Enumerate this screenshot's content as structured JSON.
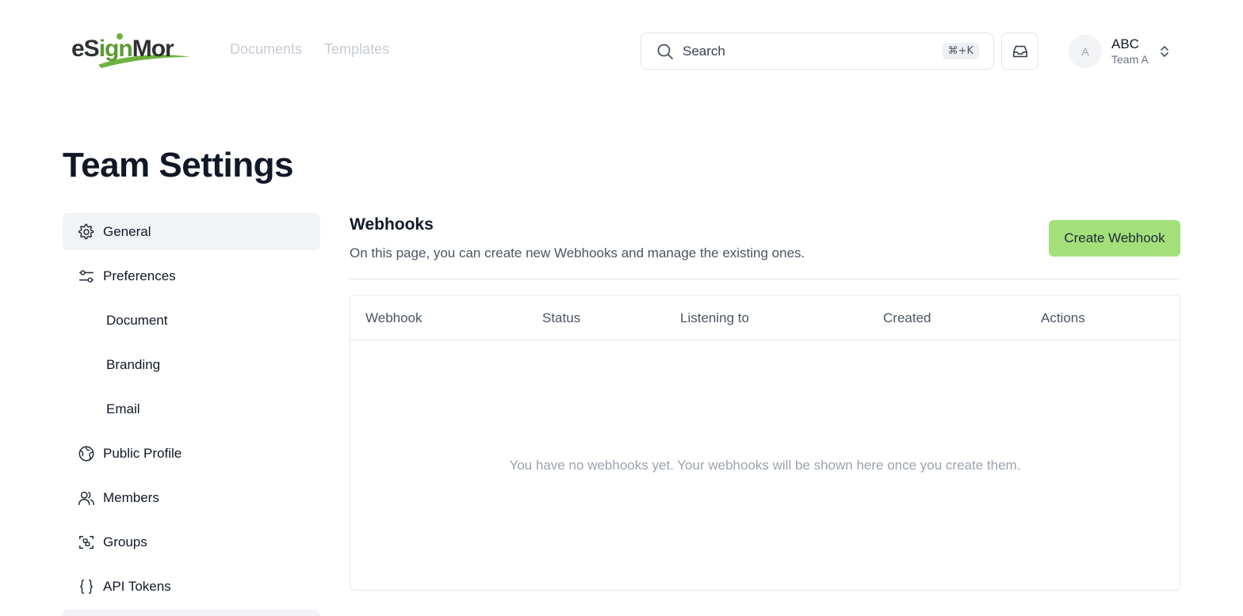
{
  "header": {
    "logo": {
      "part1": "eS",
      "part2": "ign",
      "part3": "Mor"
    },
    "nav": [
      {
        "label": "Documents"
      },
      {
        "label": "Templates"
      }
    ],
    "search": {
      "label": "Search",
      "shortcut": "⌘+K"
    },
    "account": {
      "avatar_initial": "A",
      "name": "ABC",
      "team": "Team A"
    }
  },
  "page": {
    "title": "Team Settings"
  },
  "sidebar": {
    "items": [
      {
        "label": "General",
        "icon": "gear-icon",
        "active": true
      },
      {
        "label": "Preferences",
        "icon": "sliders-icon"
      },
      {
        "label": "Document"
      },
      {
        "label": "Branding"
      },
      {
        "label": "Email"
      },
      {
        "label": "Public Profile",
        "icon": "globe-icon"
      },
      {
        "label": "Members",
        "icon": "users-icon"
      },
      {
        "label": "Groups",
        "icon": "group-scan-icon"
      },
      {
        "label": "API Tokens",
        "icon": "braces-icon"
      }
    ]
  },
  "main": {
    "title": "Webhooks",
    "description": "On this page, you can create new Webhooks and manage the existing ones.",
    "create_button": "Create Webhook",
    "table": {
      "columns": [
        "Webhook",
        "Status",
        "Listening to",
        "Created",
        "Actions"
      ],
      "empty_message": "You have no webhooks yet. Your webhooks will be shown here once you create them."
    }
  },
  "colors": {
    "accent": "#a3e07a",
    "active_bg": "#f1f3f6",
    "brand_green": "#5a9a32"
  }
}
